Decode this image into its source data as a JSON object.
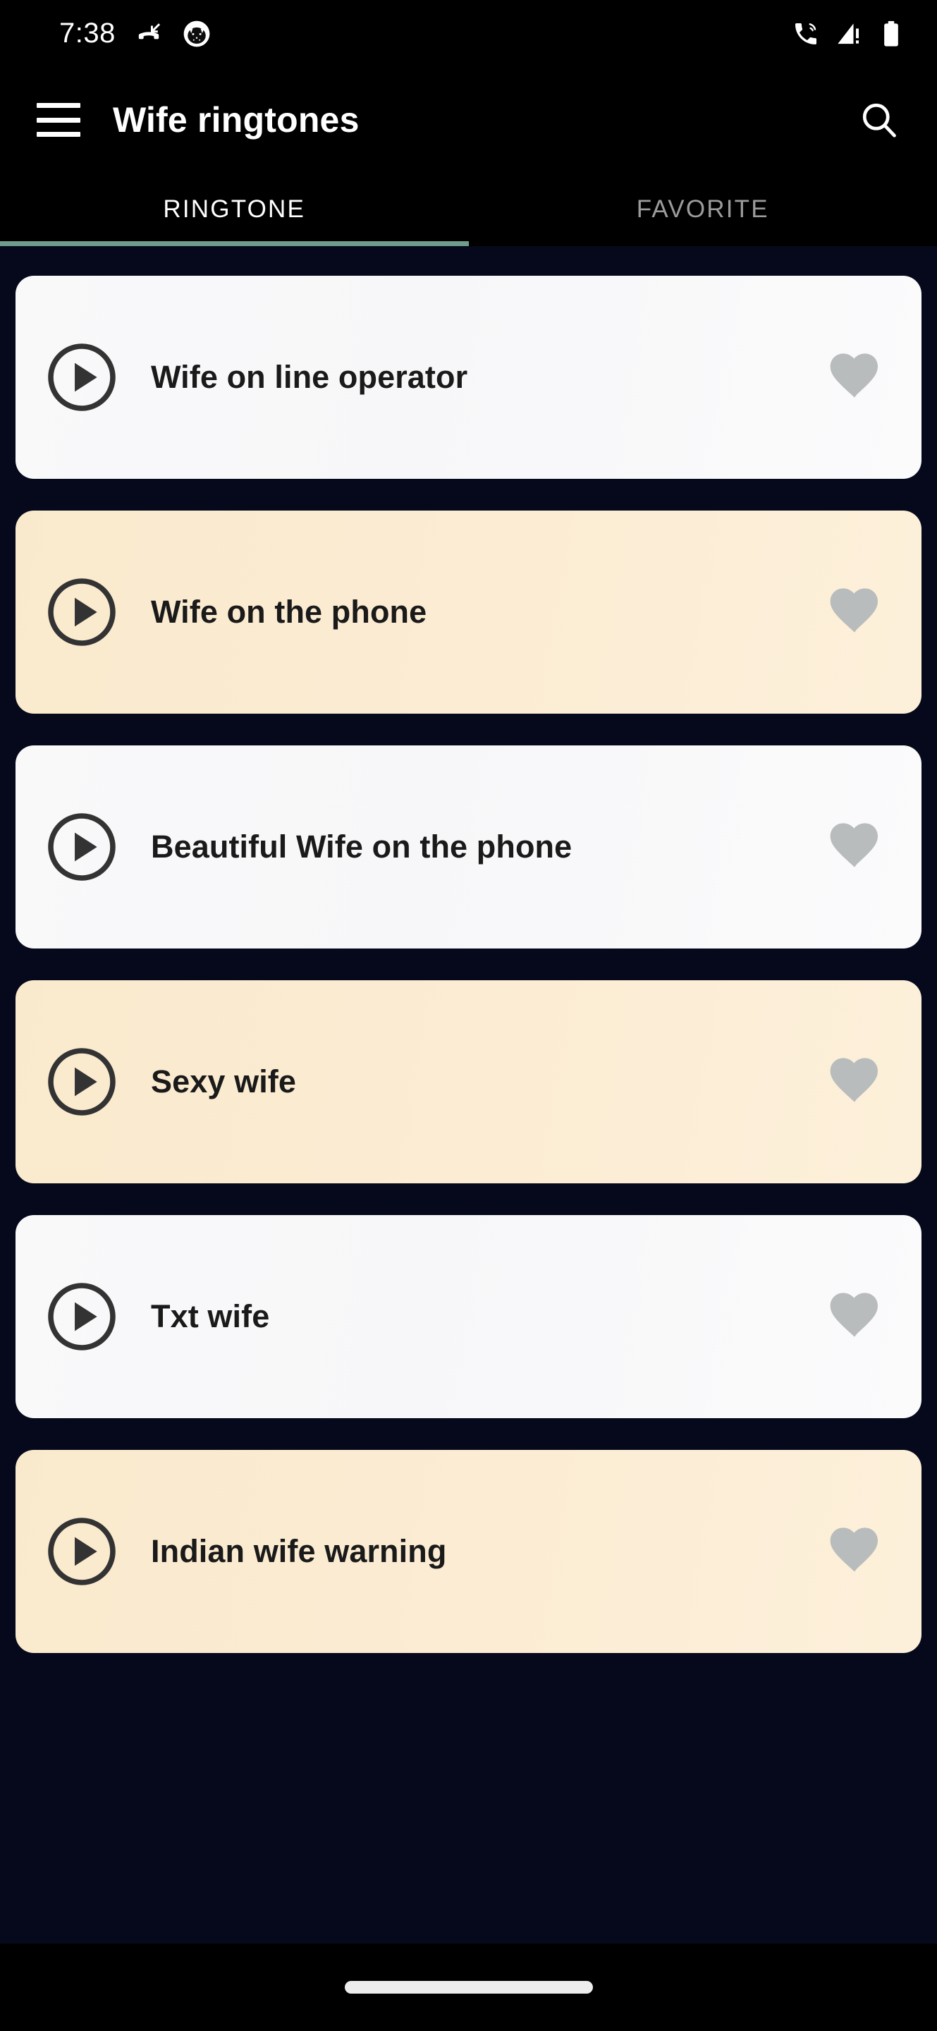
{
  "status_bar": {
    "time": "7:38",
    "left_icons": [
      {
        "name": "missed-call-icon"
      },
      {
        "name": "app-notification-icon"
      }
    ],
    "right_icons": [
      {
        "name": "phone-ringer-icon"
      },
      {
        "name": "signal-no-sim-icon"
      },
      {
        "name": "battery-full-icon"
      }
    ]
  },
  "app_bar": {
    "menu_icon": "hamburger-menu-icon",
    "title": "Wife ringtones",
    "search_icon": "search-icon"
  },
  "tabs": {
    "indicator_color": "#6f9c8c",
    "items": [
      {
        "label": "RINGTONE",
        "active": true
      },
      {
        "label": "FAVORITE",
        "active": false
      }
    ]
  },
  "colors": {
    "background": "#05091b",
    "bar_background": "#000000",
    "card_light": "#f9f9fa",
    "card_cream": "#faeacd",
    "accent": "#6f9c8c",
    "title_text": "#1a1a1a",
    "favorite_icon": "#b8bcbc",
    "play_icon": "#333333"
  },
  "ringtones": [
    {
      "title": "Wife on line operator",
      "style": "light",
      "play_icon": "play-circle-icon",
      "favorite_icon": "heart-icon",
      "favorited": false
    },
    {
      "title": "Wife on the phone",
      "style": "cream",
      "play_icon": "play-circle-icon",
      "favorite_icon": "heart-icon",
      "favorited": false
    },
    {
      "title": "Beautiful Wife on the phone",
      "style": "light",
      "play_icon": "play-circle-icon",
      "favorite_icon": "heart-icon",
      "favorited": false
    },
    {
      "title": "Sexy wife",
      "style": "cream",
      "play_icon": "play-circle-icon",
      "favorite_icon": "heart-icon",
      "favorited": false
    },
    {
      "title": "Txt wife",
      "style": "light",
      "play_icon": "play-circle-icon",
      "favorite_icon": "heart-icon",
      "favorited": false
    },
    {
      "title": "Indian wife warning",
      "style": "cream",
      "play_icon": "play-circle-icon",
      "favorite_icon": "heart-icon",
      "favorited": false
    }
  ],
  "nav_bar": {
    "gesture_pill": "home-gesture-pill"
  }
}
